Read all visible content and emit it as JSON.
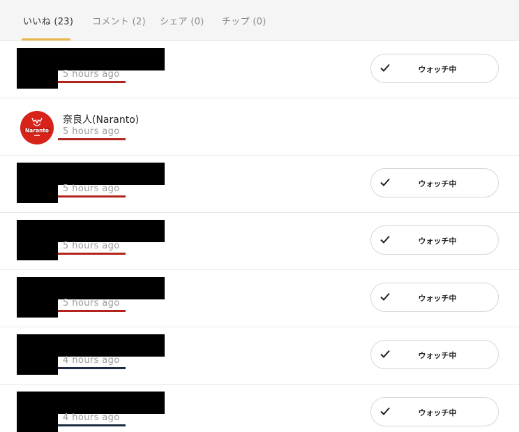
{
  "tabs": [
    {
      "label": "いいね (23)",
      "active": true
    },
    {
      "label": "コメント (2)",
      "active": false
    },
    {
      "label": "シェア (0)",
      "active": false
    },
    {
      "label": "チップ (0)",
      "active": false
    }
  ],
  "accent_color": "#e8b64a",
  "rows": [
    {
      "time": "5 hours ago",
      "watch_label": "ウォッチ中",
      "underline": "#b2231e"
    },
    {
      "name": "奈良人(Naranto)",
      "time": "5 hours ago",
      "avatar_text": "Naranto",
      "avatar_color": "#d7231a",
      "underline": "#b2231e"
    },
    {
      "time": "5 hours ago",
      "watch_label": "ウォッチ中",
      "underline": "#b2231e"
    },
    {
      "time": "5 hours ago",
      "watch_label": "ウォッチ中",
      "underline": "#b2231e"
    },
    {
      "time": "5 hours ago",
      "watch_label": "ウォッチ中",
      "underline": "#b2231e"
    },
    {
      "time": "4 hours ago",
      "watch_label": "ウォッチ中",
      "underline": "#1b2b40"
    },
    {
      "time": "4 hours ago",
      "watch_label": "ウォッチ中",
      "underline": "#1b2b40"
    }
  ]
}
